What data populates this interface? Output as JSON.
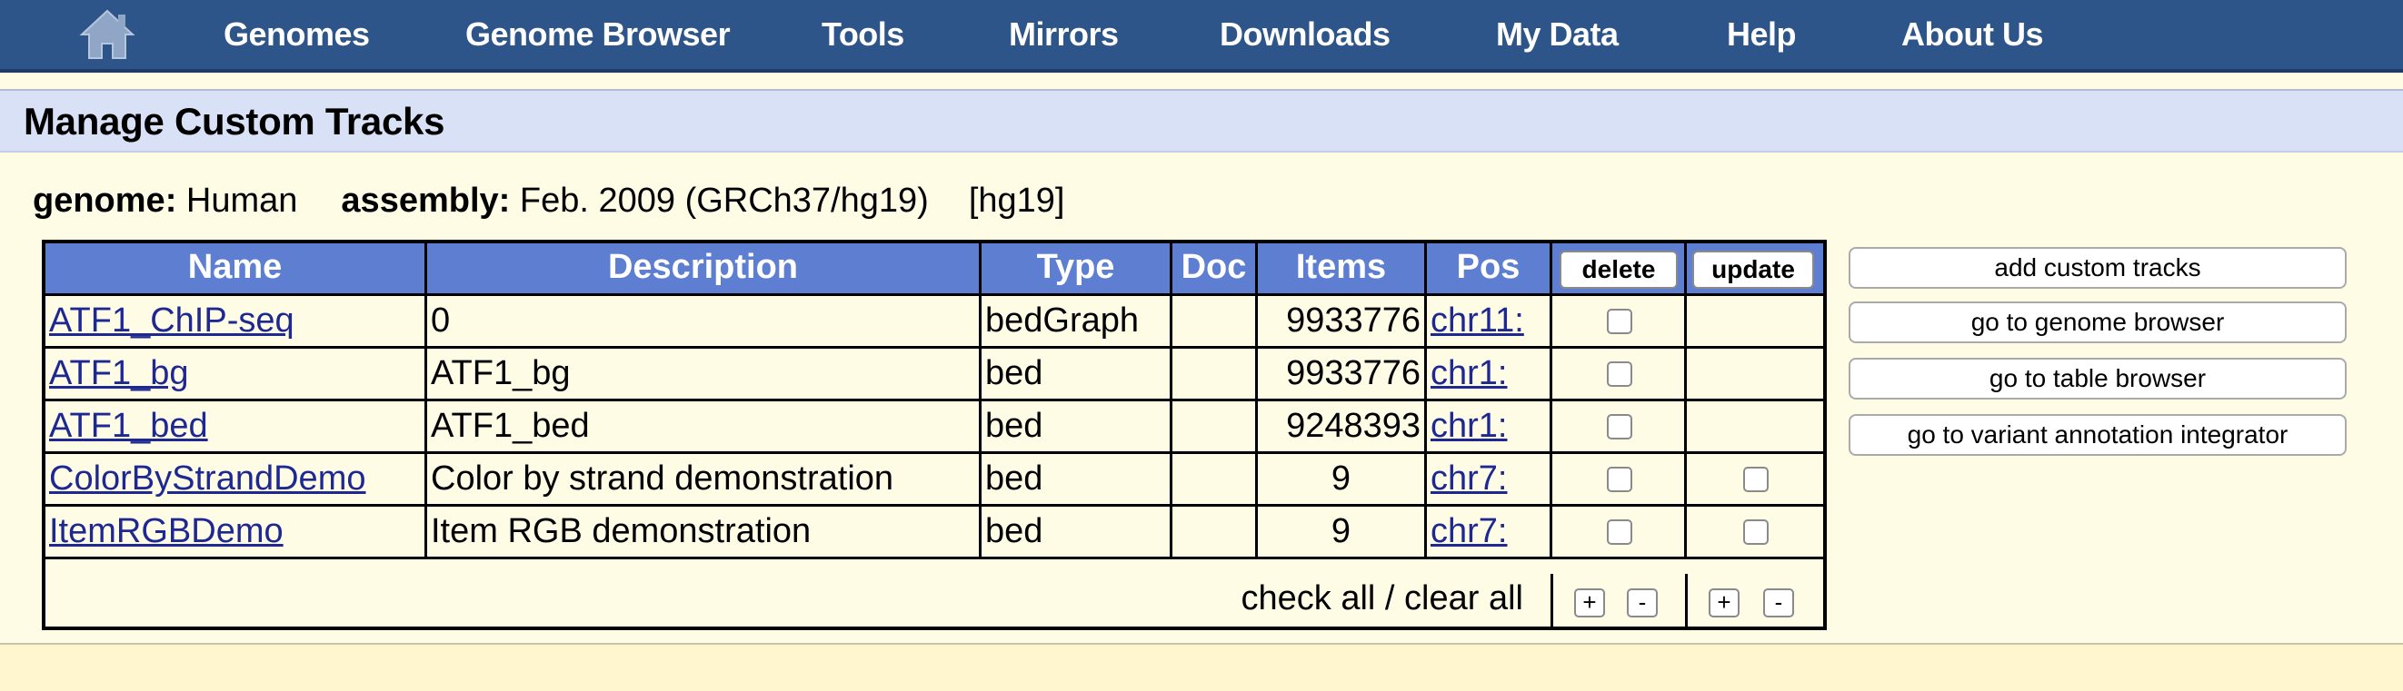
{
  "nav": {
    "home_icon": "home-icon",
    "items": [
      "Genomes",
      "Genome Browser",
      "Tools",
      "Mirrors",
      "Downloads",
      "My Data",
      "Help",
      "About Us"
    ]
  },
  "page": {
    "title": "Manage Custom Tracks"
  },
  "genome": {
    "genome_label": "genome:",
    "genome_value": "Human",
    "assembly_label": "assembly:",
    "assembly_value": "Feb. 2009 (GRCh37/hg19)",
    "db": "[hg19]"
  },
  "table": {
    "headers": [
      "Name",
      "Description",
      "Type",
      "Doc",
      "Items",
      "Pos"
    ],
    "delete_label": "delete",
    "update_label": "update",
    "rows": [
      {
        "name": "ATF1_ChIP-seq",
        "description": "0",
        "type": "bedGraph",
        "doc": "",
        "items": "9933776",
        "pos": "chr11:",
        "delete_checked": false,
        "has_update": false
      },
      {
        "name": "ATF1_bg",
        "description": "ATF1_bg",
        "type": "bed",
        "doc": "",
        "items": "9933776",
        "pos": "chr1:",
        "delete_checked": false,
        "has_update": false
      },
      {
        "name": "ATF1_bed",
        "description": "ATF1_bed",
        "type": "bed",
        "doc": "",
        "items": "9248393",
        "pos": "chr1:",
        "delete_checked": false,
        "has_update": false
      },
      {
        "name": "ColorByStrandDemo",
        "description": "Color by strand demonstration",
        "type": "bed",
        "doc": "",
        "items": "9",
        "pos": "chr7:",
        "delete_checked": false,
        "has_update": true,
        "update_checked": false
      },
      {
        "name": "ItemRGBDemo",
        "description": "Item RGB demonstration",
        "type": "bed",
        "doc": "",
        "items": "9",
        "pos": "chr7:",
        "delete_checked": false,
        "has_update": true,
        "update_checked": false
      }
    ],
    "check_all_text": "check all / clear all",
    "plus": "+",
    "minus": "-"
  },
  "actions": [
    "add custom tracks",
    "go to genome browser",
    "go to table browser",
    "go to variant annotation integrator"
  ],
  "colors": {
    "navbar": "#2e5589",
    "header_cell": "#5e7fd1",
    "section_header": "#d9e1f6",
    "page_bg": "#fffce6",
    "link": "#1d2893"
  }
}
